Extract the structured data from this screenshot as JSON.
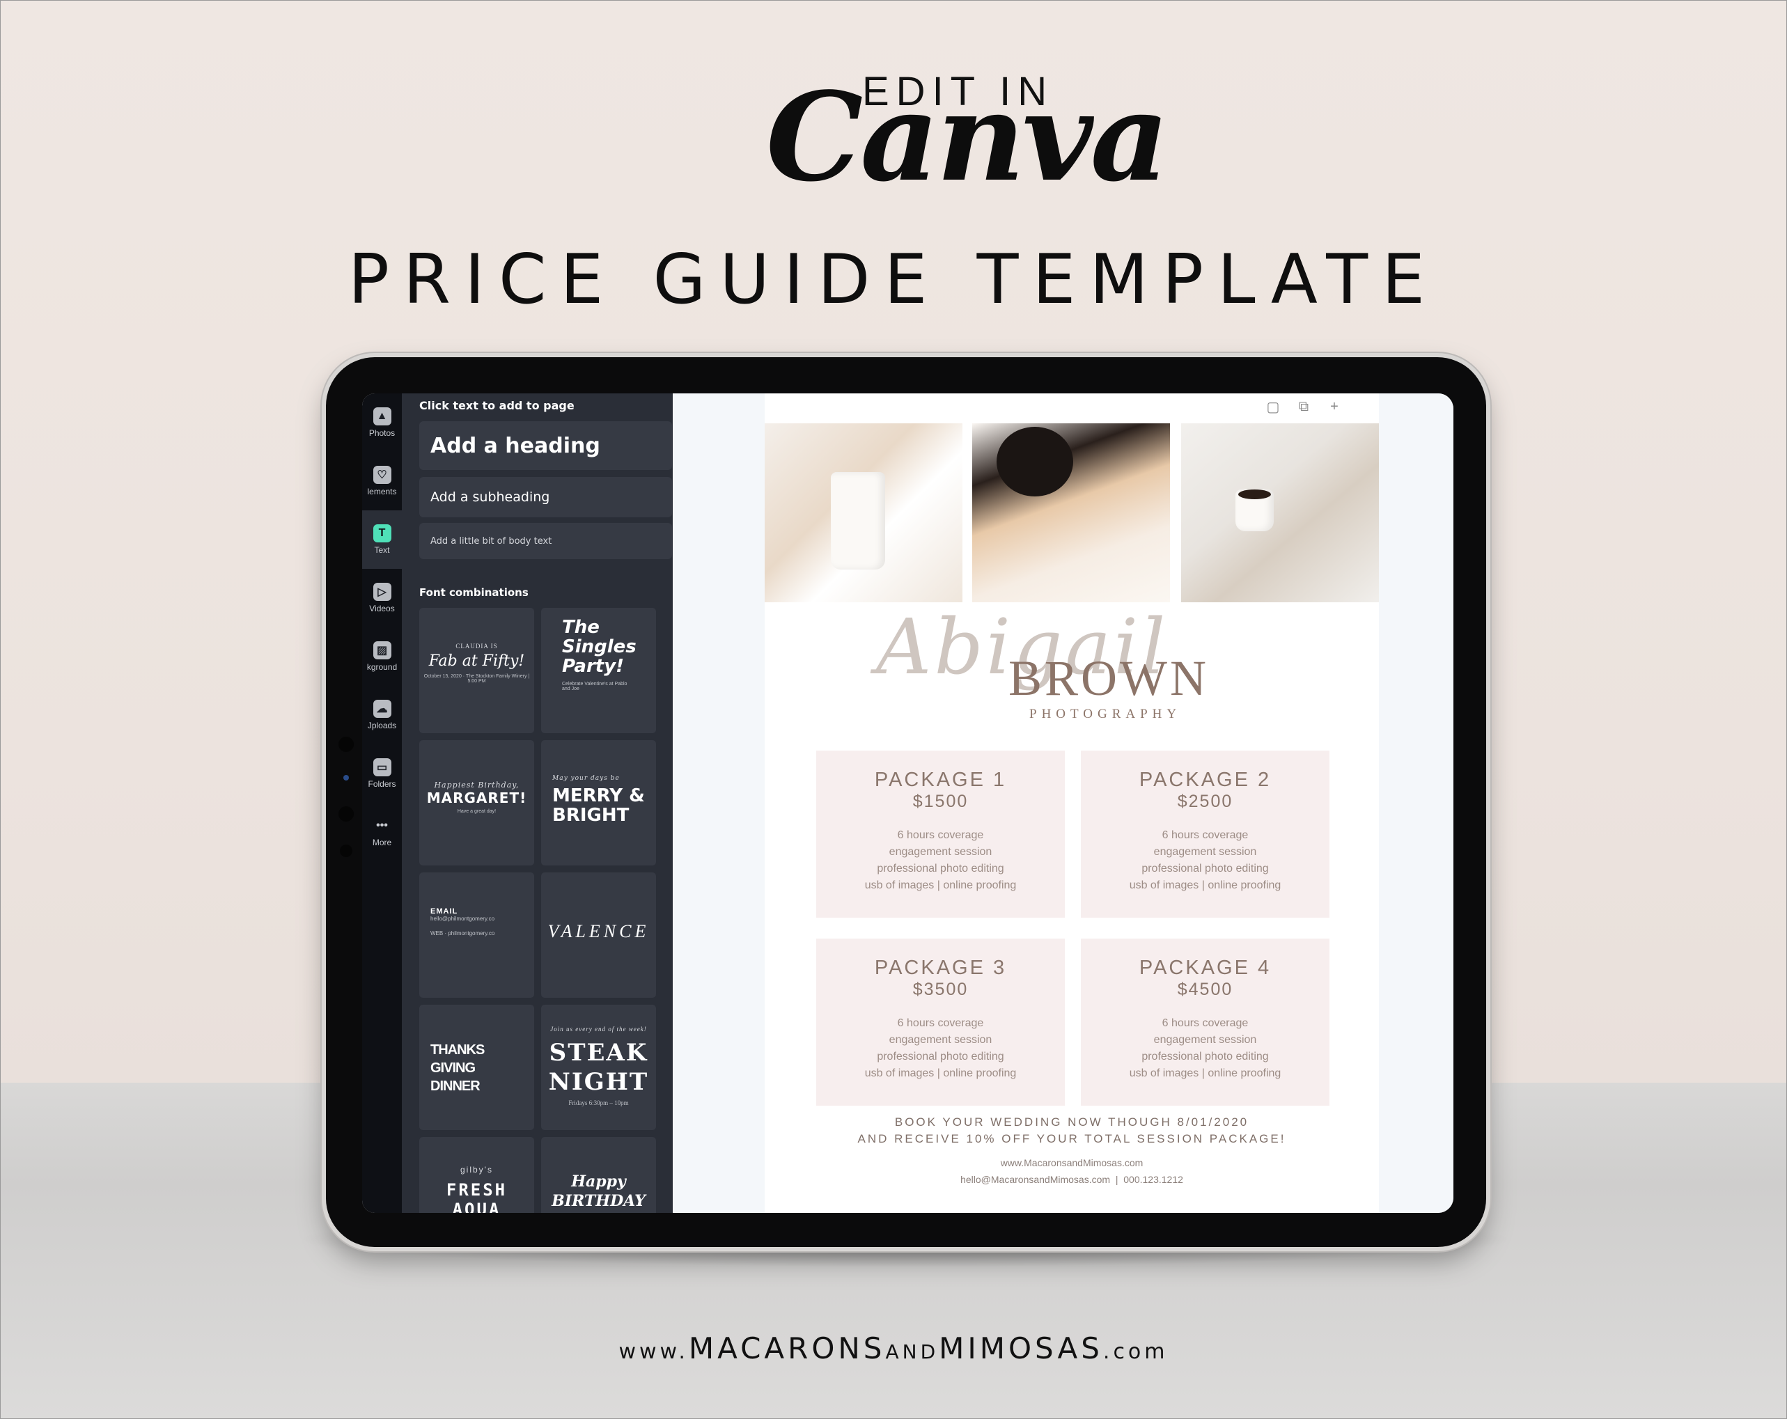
{
  "banner": {
    "edit_in": "EDIT IN",
    "canva": "Canva",
    "headline": "PRICE GUIDE TEMPLATE",
    "site_url": {
      "prefix": "www.",
      "part1": "MACARONS",
      "part2": "AND",
      "part3": "MIMOSAS",
      "suffix": ".com"
    }
  },
  "editor": {
    "rail": [
      {
        "label": "Photos",
        "icon": "photo-icon",
        "glyph": "▲"
      },
      {
        "label": "Elements",
        "icon": "shapes-icon",
        "glyph": "♡"
      },
      {
        "label": "Text",
        "icon": "text-icon",
        "glyph": "T",
        "active": true
      },
      {
        "label": "Videos",
        "icon": "play-icon",
        "glyph": "▷"
      },
      {
        "label": "Background",
        "icon": "background-icon",
        "glyph": "▨"
      },
      {
        "label": "Uploads",
        "icon": "cloud-upload-icon",
        "glyph": "☁"
      },
      {
        "label": "Folders",
        "icon": "folder-icon",
        "glyph": "▭"
      },
      {
        "label": "More",
        "icon": "more-icon",
        "glyph": "•••"
      }
    ],
    "rail_labels_visible": [
      "Photos",
      "lements",
      "Text",
      "Videos",
      "kground",
      "Jploads",
      "Folders",
      "More"
    ],
    "panel": {
      "title": "Click text to add to page",
      "heading": "Add a heading",
      "subheading": "Add a subheading",
      "body": "Add a little bit of body text",
      "section_title": "Font combinations",
      "tiles": [
        {
          "l1": "CLAUDIA IS",
          "l2": "Fab at Fifty!",
          "l3": "October 15, 2020 · The Stockton Family Winery | 5:00 PM"
        },
        {
          "l1": "",
          "l2": "The Singles Party!",
          "l3": "Celebrate Valentine's at Pablo and Joe"
        },
        {
          "l1": "Happiest Birthday,",
          "l2": "MARGARET!",
          "l3": "Have a great day!"
        },
        {
          "l1": "May your days be",
          "l2": "MERRY & BRIGHT",
          "l3": ""
        },
        {
          "l1": "EMAIL",
          "l2": "hello@philmontgomery.co",
          "l3": "WEB · philmontgomery.co"
        },
        {
          "l1": "",
          "l2": "VALENCE",
          "l3": ""
        },
        {
          "l1": "",
          "l2": "THANKS GIVING DINNER",
          "l3": ""
        },
        {
          "l1": "Join us every end of the week!",
          "l2": "STEAK NIGHT",
          "l3": "Fridays 6:30pm – 10pm"
        },
        {
          "l1": "gilby's",
          "l2": "FRESH AQUA",
          "l3": ""
        },
        {
          "l1": "",
          "l2": "Happy BIRTHDAY",
          "l3": ""
        }
      ]
    },
    "collapse_icon": "‹",
    "page_tools": [
      {
        "name": "notes-icon",
        "glyph": "▢"
      },
      {
        "name": "duplicate-page-icon",
        "glyph": "⧉"
      },
      {
        "name": "add-page-icon",
        "glyph": "+"
      }
    ]
  },
  "document": {
    "logo_script": "Abigail",
    "logo_name": "BROWN",
    "logo_tagline": "PHOTOGRAPHY",
    "packages": [
      {
        "name": "PACKAGE 1",
        "price": "$1500",
        "features": [
          "6 hours coverage",
          "engagement session",
          "professional photo editing",
          "usb of images | online proofing"
        ]
      },
      {
        "name": "PACKAGE 2",
        "price": "$2500",
        "features": [
          "6 hours coverage",
          "engagement session",
          "professional photo editing",
          "usb of images | online proofing"
        ]
      },
      {
        "name": "PACKAGE 3",
        "price": "$3500",
        "features": [
          "6 hours coverage",
          "engagement session",
          "professional photo editing",
          "usb of images | online proofing"
        ]
      },
      {
        "name": "PACKAGE 4",
        "price": "$4500",
        "features": [
          "6 hours coverage",
          "engagement session",
          "professional photo editing",
          "usb of images | online proofing"
        ]
      }
    ],
    "promo_line1": "BOOK YOUR WEDDING NOW THOUGH 8/01/2020",
    "promo_line2": "AND RECEIVE 10% OFF YOUR TOTAL SESSION PACKAGE!",
    "website": "www.MacaronsandMimosas.com",
    "contact": "hello@MacaronsandMimosas.com  |  000.123.1212",
    "colors": {
      "accent": "#8c7468",
      "package_bg": "#f7eeee",
      "rail_active": "#4fe0b8",
      "panel_bg": "#2a2e37"
    }
  }
}
